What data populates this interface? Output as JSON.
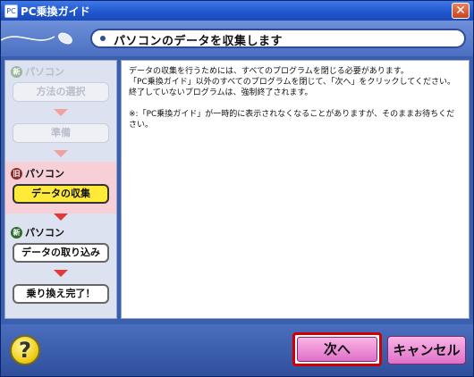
{
  "window": {
    "title": "PC乗換ガイド",
    "close_glyph": "✕",
    "app_icon": "pc-icon"
  },
  "header": {
    "title": "パソコンのデータを収集します"
  },
  "sidebar": {
    "new_top": {
      "badge": "新",
      "label": "パソコン"
    },
    "steps_top": [
      "方法の選択",
      "準備"
    ],
    "old": {
      "badge": "旧",
      "label": "パソコン",
      "step": "データの収集"
    },
    "new_bottom": {
      "badge": "新",
      "label": "パソコン",
      "steps": [
        "データの取り込み",
        "乗り換え完了！"
      ]
    }
  },
  "content": {
    "line1": "データの収集を行うためには、すべてのプログラムを閉じる必要があります。",
    "line2": "「PC乗換ガイド」以外のすべてのプログラムを閉じて、「次へ」をクリックしてください。",
    "line3": "終了していないプログラムは、強制終了されます。",
    "note": "※:「PC乗換ガイド」が一時的に表示されなくなることがありますが、そのままお待ちください。"
  },
  "footer": {
    "help_glyph": "?",
    "next_label": "次へ",
    "cancel_label": "キャンセル"
  },
  "colors": {
    "active_step": "#ffea3a",
    "arrow": "#e03a3a",
    "old_band": "#f7cfd6",
    "button_pink": "#e070c8",
    "highlight": "#d00000"
  }
}
